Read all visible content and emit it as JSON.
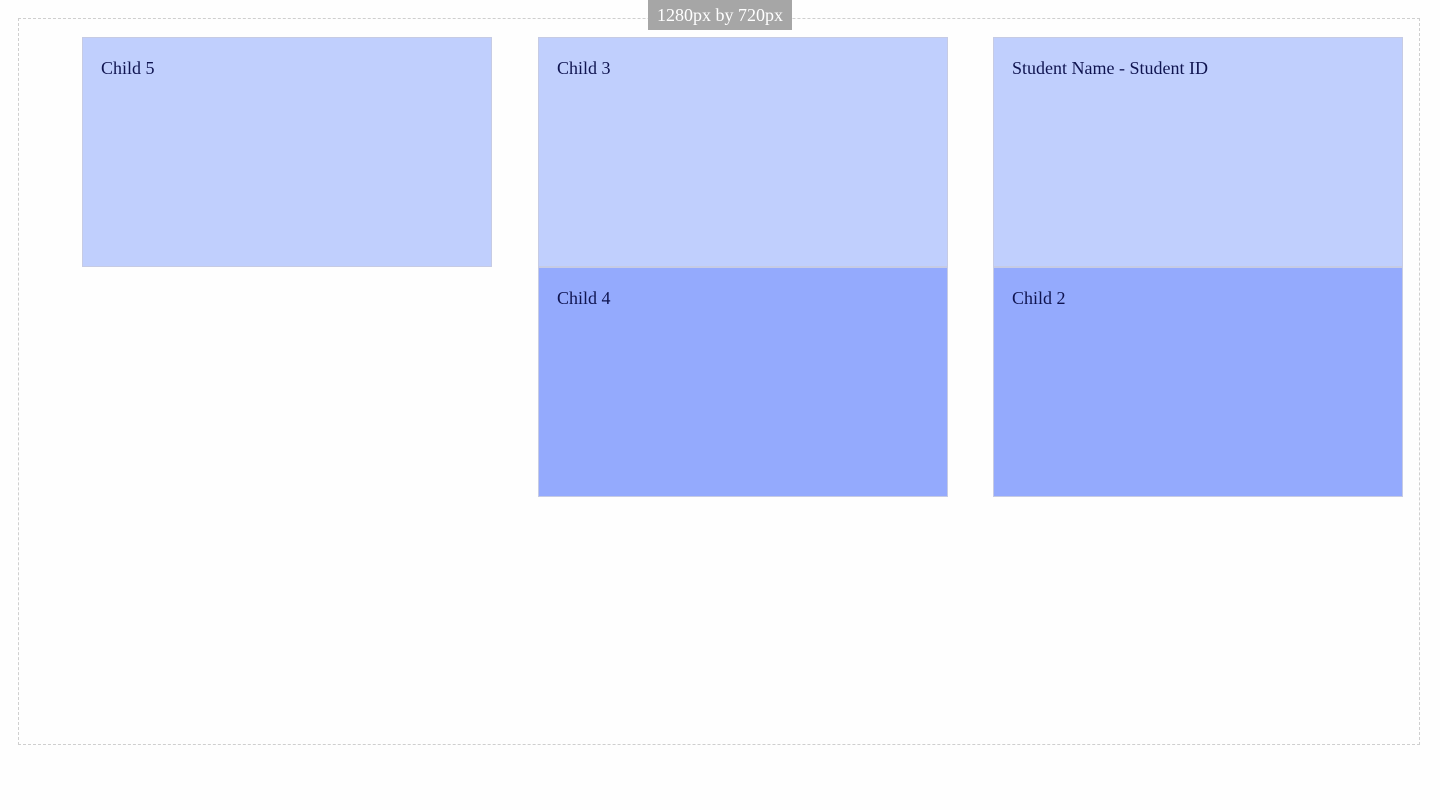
{
  "viewport_label": "1280px by 720px",
  "colors": {
    "light_box": "#c0cffd",
    "dark_box": "#94aafd",
    "text": "#0f1450",
    "label_bg": "#a6a6a6"
  },
  "boxes": {
    "child5": "Child 5",
    "child3": "Child 3",
    "child4": "Child 4",
    "student": "Student Name - Student ID",
    "child2": "Child 2"
  }
}
